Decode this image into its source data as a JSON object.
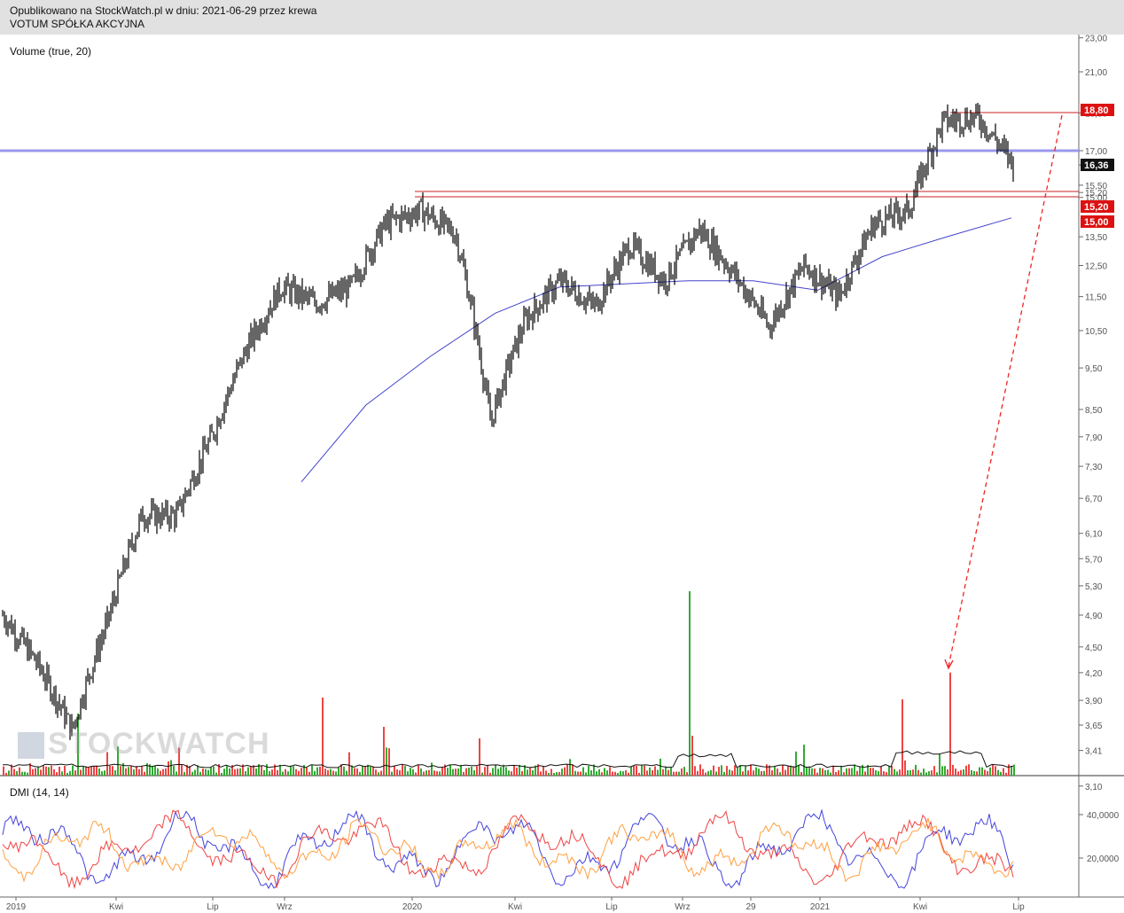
{
  "header": {
    "line1": "Opublikowano na StockWatch.pl w dniu: 2021-06-29 przez krewa",
    "line2": "VOTUM SPÓŁKA AKCYJNA"
  },
  "watermark": "STOCKWATCH",
  "price_axis_ticks": [
    "23,00",
    "21,00",
    "18,80",
    "17,00",
    "16,36",
    "15,50",
    "15,20",
    "15,00",
    "13,50",
    "12,50",
    "11,50",
    "10,50",
    "9,50",
    "8,50",
    "7,90",
    "7,30",
    "6,70",
    "6,10",
    "5,70",
    "5,30",
    "4,90",
    "4,50",
    "4,20",
    "3,90",
    "3,65",
    "3,41",
    "3,10"
  ],
  "dmi_axis_ticks": [
    "40,0000",
    "20,0000"
  ],
  "time_axis_labels": [
    "2019",
    "Kwi",
    "Lip",
    "Wrz",
    "2020",
    "Kwi",
    "Lip",
    "Wrz",
    "29",
    "2021",
    "Kwi",
    "Lip"
  ],
  "panels": {
    "volume_label": "Volume (true, 20)",
    "dmi_label": "DMI (14, 14)"
  },
  "tags": [
    {
      "text": "18,80",
      "color": "#dd1111"
    },
    {
      "text": "16,36",
      "color": "#111111"
    },
    {
      "text": "15,20",
      "color": "#dd1111"
    },
    {
      "text": "15,00",
      "color": "#dd1111"
    }
  ],
  "colors": {
    "up_volume": "#33aa33",
    "down_volume": "#ee4444",
    "ma": "#4444cc",
    "dmi_plus": "#4444dd",
    "dmi_minus": "#ee4444",
    "adx": "#ffa040",
    "resistance": "#cc2222",
    "support": "#9999ee"
  },
  "chart_data": {
    "type": "line",
    "title": "",
    "series": [
      {
        "name": "",
        "x": [
          "2019-01",
          "2019-02",
          "2019-03",
          "2019-04",
          "2019-05",
          "2019-06",
          "2019-07",
          "2019-08",
          "2019-09",
          "2019-10",
          "2019-11",
          "2019-12",
          "2020-01",
          "2020-02",
          "2020-03",
          "2020-04",
          "2020-05",
          "2020-06",
          "2020-07",
          "2020-08",
          "2020-09",
          "2020-10",
          "2020-11",
          "2020-12",
          "2021-01",
          "2021-02",
          "2021-03",
          "2021-04",
          "2021-05",
          "2021-06"
        ],
        "y": [
          4.9,
          4.3,
          3.6,
          4.8,
          6.4,
          6.4,
          7.9,
          10.0,
          11.8,
          11.3,
          11.8,
          14.0,
          14.5,
          13.6,
          8.2,
          10.8,
          12.0,
          11.2,
          13.2,
          12.0,
          13.8,
          12.2,
          10.6,
          12.5,
          11.5,
          14.0,
          14.5,
          18.4,
          18.6,
          16.4
        ]
      },
      {
        "name": "",
        "x": [
          "2019-08",
          "2019-10",
          "2019-12",
          "2020-02",
          "2020-04",
          "2020-06",
          "2020-08",
          "2020-10",
          "2020-12",
          "2021-02",
          "2021-04",
          "2021-06"
        ],
        "y": [
          7.0,
          8.6,
          9.8,
          11.0,
          11.8,
          11.9,
          12.0,
          12.0,
          11.7,
          12.8,
          13.5,
          14.2
        ]
      }
    ],
    "levels": [
      18.8,
      17.0,
      15.2,
      15.0
    ]
  }
}
